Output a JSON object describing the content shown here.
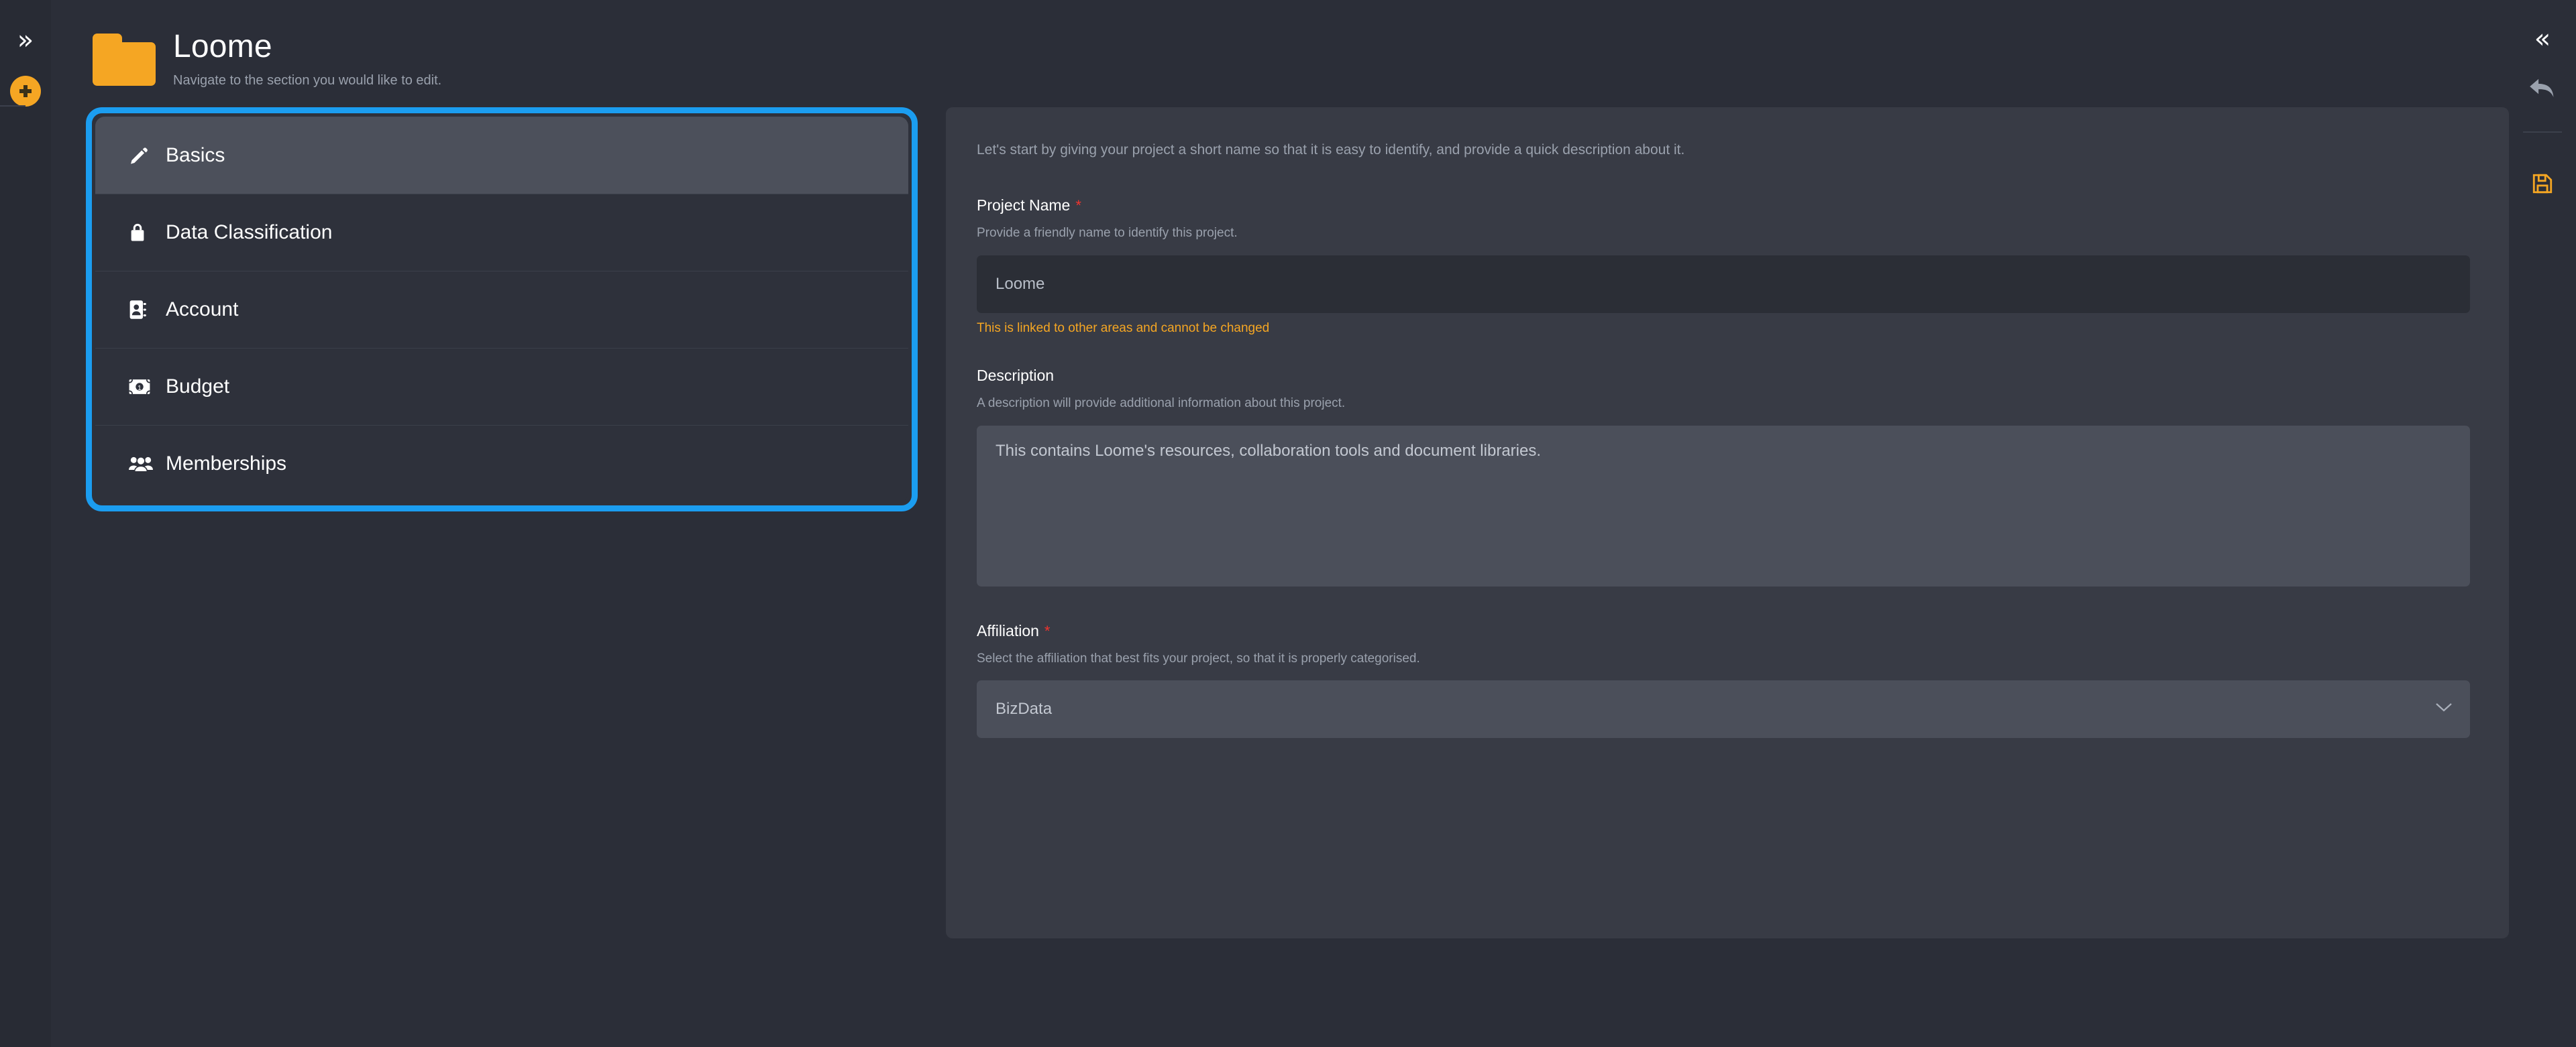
{
  "left_rail": {
    "expand_label": "»",
    "add_icon": "plus-circle-icon"
  },
  "right_rail": {
    "collapse_label": "«",
    "undo_icon": "undo-arrow-icon",
    "save_icon": "save-floppy-icon"
  },
  "header": {
    "icon": "folder-icon",
    "title": "Loome",
    "subtitle": "Navigate to the section you would like to edit."
  },
  "nav": {
    "items": [
      {
        "label": "Basics",
        "icon": "pencil-icon",
        "active": true
      },
      {
        "label": "Data Classification",
        "icon": "lock-icon",
        "active": false
      },
      {
        "label": "Account",
        "icon": "address-book-icon",
        "active": false
      },
      {
        "label": "Budget",
        "icon": "money-bill-icon",
        "active": false
      },
      {
        "label": "Memberships",
        "icon": "users-icon",
        "active": false
      }
    ]
  },
  "form": {
    "intro": "Let's start by giving your project a short name so that it is easy to identify, and provide a quick description about it.",
    "project_name": {
      "label": "Project Name",
      "required_marker": "*",
      "hint": "Provide a friendly name to identify this project.",
      "value": "Loome",
      "placeholder": "Project Name",
      "warning": "This is linked to other areas and cannot be changed"
    },
    "description": {
      "label": "Description",
      "hint": "A description will provide additional information about this project.",
      "value": "This contains Loome's resources, collaboration tools and document libraries.",
      "placeholder": "Description"
    },
    "affiliation": {
      "label": "Affiliation",
      "required_marker": "*",
      "hint": "Select the affiliation that best fits your project, so that it is properly categorised.",
      "value": "BizData",
      "chevron_icon": "chevron-down-icon"
    }
  },
  "colors": {
    "accent_orange": "#f5a623",
    "highlight_blue": "#1b9df0",
    "required_red": "#f0342e",
    "panel_bg": "#383b45",
    "page_bg": "#2b2e38"
  }
}
